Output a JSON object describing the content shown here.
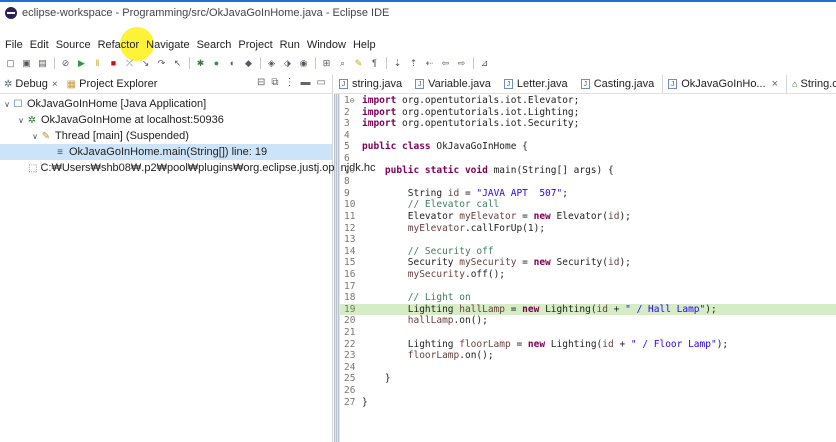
{
  "window": {
    "title": "eclipse-workspace - Programming/src/OkJavaGoInHome.java - Eclipse IDE"
  },
  "menu": [
    "File",
    "Edit",
    "Source",
    "Refactor",
    "Navigate",
    "Search",
    "Project",
    "Run",
    "Window",
    "Help"
  ],
  "left_view": {
    "tabs": [
      {
        "label": "Debug",
        "icon": "debug-icon"
      },
      {
        "label": "Project Explorer",
        "icon": "project-explorer-icon"
      }
    ],
    "tree": [
      {
        "label": "OkJavaGoInHome [Java Application]",
        "level": 0
      },
      {
        "label": "OkJavaGoInHome at localhost:50936",
        "level": 1
      },
      {
        "label": "Thread [main] (Suspended)",
        "level": 2
      },
      {
        "label": "OkJavaGoInHome.main(String[]) line: 19",
        "level": 3
      },
      {
        "label": "C:₩Users₩shb08₩.p2₩pool₩plugins₩org.eclipse.justj.openjdk.hc",
        "level": 1
      }
    ]
  },
  "editor": {
    "tabs": [
      "string.java",
      "Variable.java",
      "Letter.java",
      "Casting.java",
      "OkJavaGoInHo...",
      "String.clas"
    ],
    "active_tab": "OkJavaGoInHo...",
    "current_line": 19,
    "lines": [
      {
        "n": "1",
        "fold": "⊖",
        "html": "<span class=\"kw\">import</span> org.opentutorials.iot.Elevator;"
      },
      {
        "n": "2",
        "html": "<span class=\"kw\">import</span> org.opentutorials.iot.Lighting;"
      },
      {
        "n": "3",
        "html": "<span class=\"kw\">import</span> org.opentutorials.iot.Security;"
      },
      {
        "n": "4",
        "html": ""
      },
      {
        "n": "5",
        "html": "<span class=\"kw\">public class</span> OkJavaGoInHome {"
      },
      {
        "n": "6",
        "html": ""
      },
      {
        "n": "7",
        "fold": "⊖",
        "html": "    <span class=\"kw\">public static void</span> main(String[] args) {"
      },
      {
        "n": "8",
        "html": ""
      },
      {
        "n": "9",
        "html": "        String <span class=\"var\">id</span> = <span class=\"str\">\"JAVA APT  507\"</span>;"
      },
      {
        "n": "10",
        "html": "        <span class=\"cmt\">// Elevator call</span>"
      },
      {
        "n": "11",
        "html": "        Elevator <span class=\"var\">myElevator</span> = <span class=\"kw\">new</span> Elevator(<span class=\"var\">id</span>);"
      },
      {
        "n": "12",
        "html": "        <span class=\"var\">myElevator</span>.callForUp(1);"
      },
      {
        "n": "13",
        "html": ""
      },
      {
        "n": "14",
        "html": "        <span class=\"cmt\">// Security off</span>"
      },
      {
        "n": "15",
        "html": "        Security <span class=\"var\">mySecurity</span> = <span class=\"kw\">new</span> Security(<span class=\"var\">id</span>);"
      },
      {
        "n": "16",
        "html": "        <span class=\"var\">mySecurity</span>.off();"
      },
      {
        "n": "17",
        "html": ""
      },
      {
        "n": "18",
        "html": "        <span class=\"cmt\">// Light on</span>"
      },
      {
        "n": "19",
        "html": "        Lighting <span class=\"var\">hallLamp</span> = <span class=\"kw\">new</span> Lighting(<span class=\"var\">id</span> + <span class=\"str\">\" / Hall Lamp\"</span>);"
      },
      {
        "n": "20",
        "html": "        <span class=\"var\">hallLamp</span>.on();"
      },
      {
        "n": "21",
        "html": ""
      },
      {
        "n": "22",
        "html": "        Lighting <span class=\"var\">floorLamp</span> = <span class=\"kw\">new</span> Lighting(<span class=\"var\">id</span> + <span class=\"str\">\" / Floor Lamp\"</span>);"
      },
      {
        "n": "23",
        "html": "        <span class=\"var\">floorLamp</span>.on();"
      },
      {
        "n": "24",
        "html": ""
      },
      {
        "n": "25",
        "html": "    }"
      },
      {
        "n": "26",
        "html": ""
      },
      {
        "n": "27",
        "html": "}"
      }
    ]
  },
  "colors": {
    "title_accent": "#1f6fd6",
    "current_line": "#d6ecc5",
    "selection": "#cde3f7",
    "keyword": "#7f0055",
    "string": "#2a00ff",
    "comment": "#3f7f5f"
  }
}
